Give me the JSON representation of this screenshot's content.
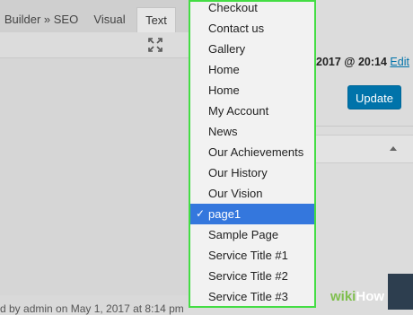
{
  "editor": {
    "tabs": [
      {
        "label": "Builder » SEO"
      },
      {
        "label": "Visual"
      },
      {
        "label": "Text"
      }
    ],
    "footer_note": "d by admin on May 1, 2017 at 8:14 pm"
  },
  "dropdown": {
    "options": [
      {
        "label": "Checkout"
      },
      {
        "label": "Contact us"
      },
      {
        "label": "Gallery"
      },
      {
        "label": "Home"
      },
      {
        "label": "Home"
      },
      {
        "label": "My Account"
      },
      {
        "label": "News"
      },
      {
        "label": "Our Achievements"
      },
      {
        "label": "Our History"
      },
      {
        "label": "Our Vision"
      },
      {
        "label": "page1"
      },
      {
        "label": "Sample Page"
      },
      {
        "label": "Service Title #1"
      },
      {
        "label": "Service Title #2"
      },
      {
        "label": "Service Title #3"
      }
    ],
    "selected": "page1",
    "checkmark": "✓",
    "highlight_border_color": "#44dd44",
    "selected_color": "#3477dd"
  },
  "publish": {
    "date": "2017 @ 20:14",
    "edit_label": "Edit",
    "update_label": "Update"
  },
  "watermark": {
    "wiki": "wiki",
    "how": "How"
  }
}
